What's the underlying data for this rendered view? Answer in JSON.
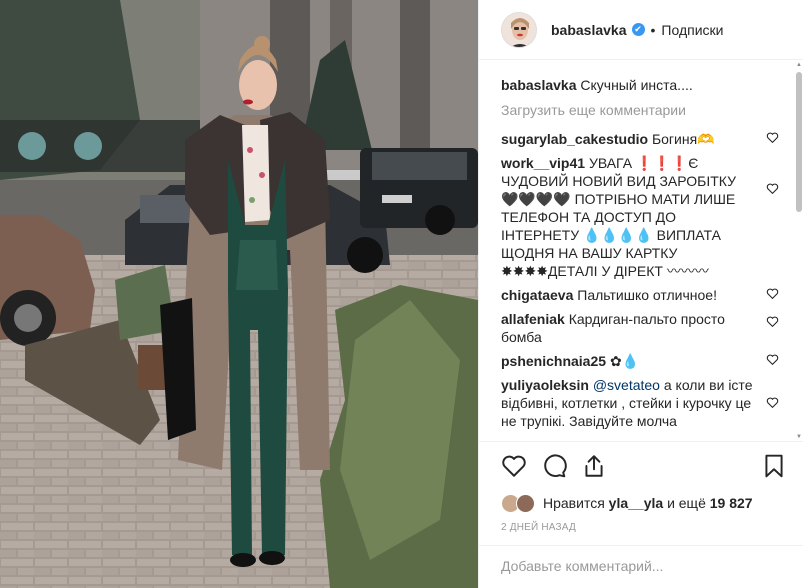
{
  "post": {
    "author": "babaslavka",
    "verified_mark": "✔",
    "dot": "•",
    "follow_label": "Подписки",
    "caption_text": "Скучный инста....",
    "load_more": "Загрузить еще комментарии",
    "comments": [
      {
        "user": "sugarylab_cakestudio",
        "text": "Богиня🫶"
      },
      {
        "user": "work__vip41",
        "text": "УВАГА ❗❗❗Є ЧУДОВИЙ НОВИЙ ВИД ЗАРОБІТКУ 🖤🖤🖤🖤 ПОТРІБНО МАТИ ЛИШЕ ТЕЛЕФОН ТА ДОСТУП ДО ІНТЕРНЕТУ 💧💧💧💧 ВИПЛАТА ЩОДНЯ НА ВАШУ КАРТКУ ✸✸✸✸ДЕТАЛІ У ДІРЕКТ 〰〰〰"
      },
      {
        "user": "chigataeva",
        "text": "Пальтишко отличное!"
      },
      {
        "user": "allafeniak",
        "text": "Кардиган-пальто просто бомба"
      },
      {
        "user": "pshenichnaia25",
        "text": "✿💧"
      },
      {
        "user": "yuliyaoleksin",
        "mention": "@svetateo",
        "text": "а коли ви істе відбивні, котлетки , стейки і курочку це не трупікі. Завідуйте молча"
      }
    ],
    "likes_prefix": "Нравится",
    "likes_user": "yla__yla",
    "likes_and": "и ещё",
    "likes_count": "19 827",
    "timestamp": "2 ДНЕЙ НАЗАД",
    "add_comment_placeholder": "Добавьте комментарий..."
  },
  "icons": {
    "like": "heart-icon",
    "comment": "comment-icon",
    "share": "share-icon",
    "save": "bookmark-icon",
    "comment_like": "small-heart-icon"
  },
  "colors": {
    "verified": "#3897f0",
    "muted": "#999999",
    "text": "#262626",
    "border": "#efefef"
  }
}
